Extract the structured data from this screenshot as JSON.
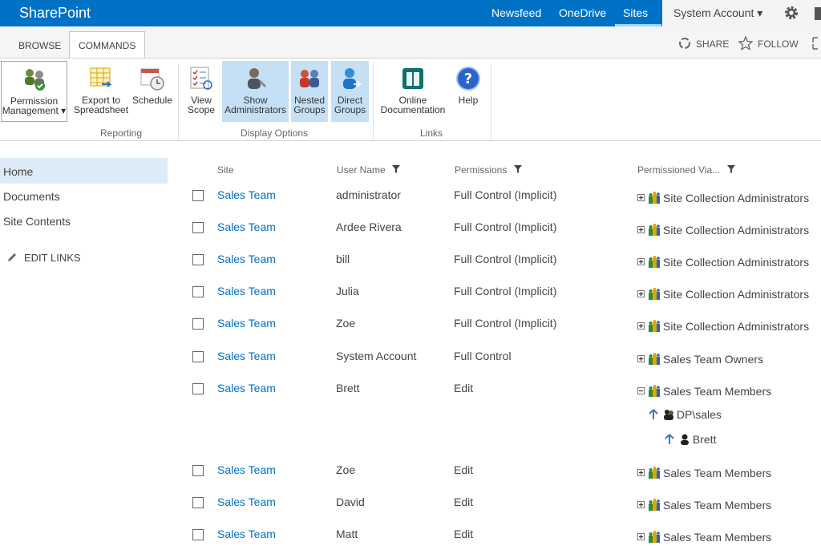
{
  "suite": {
    "brand": "SharePoint",
    "nav": [
      "Newsfeed",
      "OneDrive",
      "Sites"
    ],
    "account": "System Account ▾",
    "accent": "#0072c6"
  },
  "ribbon_tabs": {
    "browse": "BROWSE",
    "commands": "COMMANDS",
    "share": "SHARE",
    "follow": "FOLLOW"
  },
  "ribbon": {
    "permission_management": "Permission\nManagement ▾",
    "export": "Export to\nSpreadsheet",
    "schedule": "Schedule",
    "view_scope": "View\nScope",
    "show_admins": "Show\nAdministrators",
    "nested_groups": "Nested\nGroups",
    "direct_groups": "Direct\nGroups",
    "online_doc": "Online\nDocumentation",
    "help": "Help",
    "groups": {
      "reporting": "Reporting",
      "display_options": "Display Options",
      "links": "Links"
    }
  },
  "left_nav": {
    "items": [
      "Home",
      "Documents",
      "Site Contents"
    ],
    "edit_links": "EDIT LINKS"
  },
  "table": {
    "headers": {
      "site": "Site",
      "user": "User Name",
      "permissions": "Permissions",
      "via": "Permissioned Via..."
    },
    "rows": [
      {
        "site": "Sales Team",
        "user": "administrator",
        "perm": "Full Control (Implicit)",
        "via": "Site Collection Administrators"
      },
      {
        "site": "Sales Team",
        "user": "Ardee Rivera",
        "perm": "Full Control (Implicit)",
        "via": "Site Collection Administrators"
      },
      {
        "site": "Sales Team",
        "user": "bill",
        "perm": "Full Control (Implicit)",
        "via": "Site Collection Administrators"
      },
      {
        "site": "Sales Team",
        "user": "Julia",
        "perm": "Full Control (Implicit)",
        "via": "Site Collection Administrators"
      },
      {
        "site": "Sales Team",
        "user": "Zoe",
        "perm": "Full Control (Implicit)",
        "via": "Site Collection Administrators"
      },
      {
        "site": "Sales Team",
        "user": "System Account",
        "perm": "Full Control",
        "via": "Sales Team Owners"
      },
      {
        "site": "Sales Team",
        "user": "Brett",
        "perm": "Edit",
        "via": "Sales Team Members"
      },
      {
        "site": "Sales Team",
        "user": "Zoe",
        "perm": "Edit",
        "via": "Sales Team Members"
      },
      {
        "site": "Sales Team",
        "user": "David",
        "perm": "Edit",
        "via": "Sales Team Members"
      },
      {
        "site": "Sales Team",
        "user": "Matt",
        "perm": "Edit",
        "via": "Sales Team Members"
      }
    ],
    "expanded": {
      "group": "DP\\sales",
      "user": "Brett"
    }
  }
}
